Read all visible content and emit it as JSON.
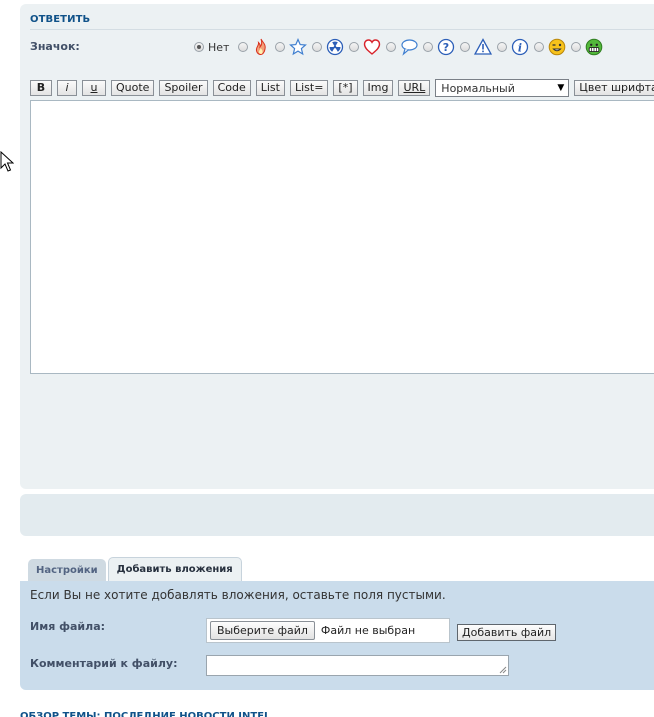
{
  "reply": {
    "title": "ОТВЕТИТЬ"
  },
  "icon_picker": {
    "label": "Значок:",
    "none_label": "Нет",
    "selected": "none",
    "icons": [
      "fire-icon",
      "star-icon",
      "radioactive-icon",
      "heart-icon",
      "speech-bubble-icon",
      "question-icon",
      "warning-icon",
      "info-icon",
      "wink-smiley-icon",
      "grin-smiley-icon"
    ]
  },
  "toolbar": {
    "bold": "B",
    "italic": "i",
    "underline": "u",
    "quote": "Quote",
    "spoiler": "Spoiler",
    "code": "Code",
    "list": "List",
    "list_ordered": "List=",
    "list_item": "[*]",
    "img": "Img",
    "url": "URL",
    "font_size_selected": "Нормальный",
    "font_color": "Цвет шрифта",
    "cutoff": "h"
  },
  "tabs": {
    "settings": "Настройки",
    "attachments": "Добавить вложения",
    "active": "attachments"
  },
  "attachments": {
    "info": "Если Вы не хотите добавлять вложения, оставьте поля пустыми.",
    "file_label": "Имя файла:",
    "choose_file_button": "Выберите файл",
    "no_file_text": "Файл не выбран",
    "add_file_button": "Добавить файл",
    "comment_label": "Комментарий к файлу:",
    "comment_value": ""
  },
  "footer": {
    "partial_text": "ОБЗОР ТЕМЫ: ПОСЛЕДНИЕ НОВОСТИ INTEL"
  },
  "colors": {
    "panel_bg": "#ecf1f3",
    "attach_bg": "#cadceb",
    "link_blue": "#105289",
    "label_gray": "#425067"
  }
}
